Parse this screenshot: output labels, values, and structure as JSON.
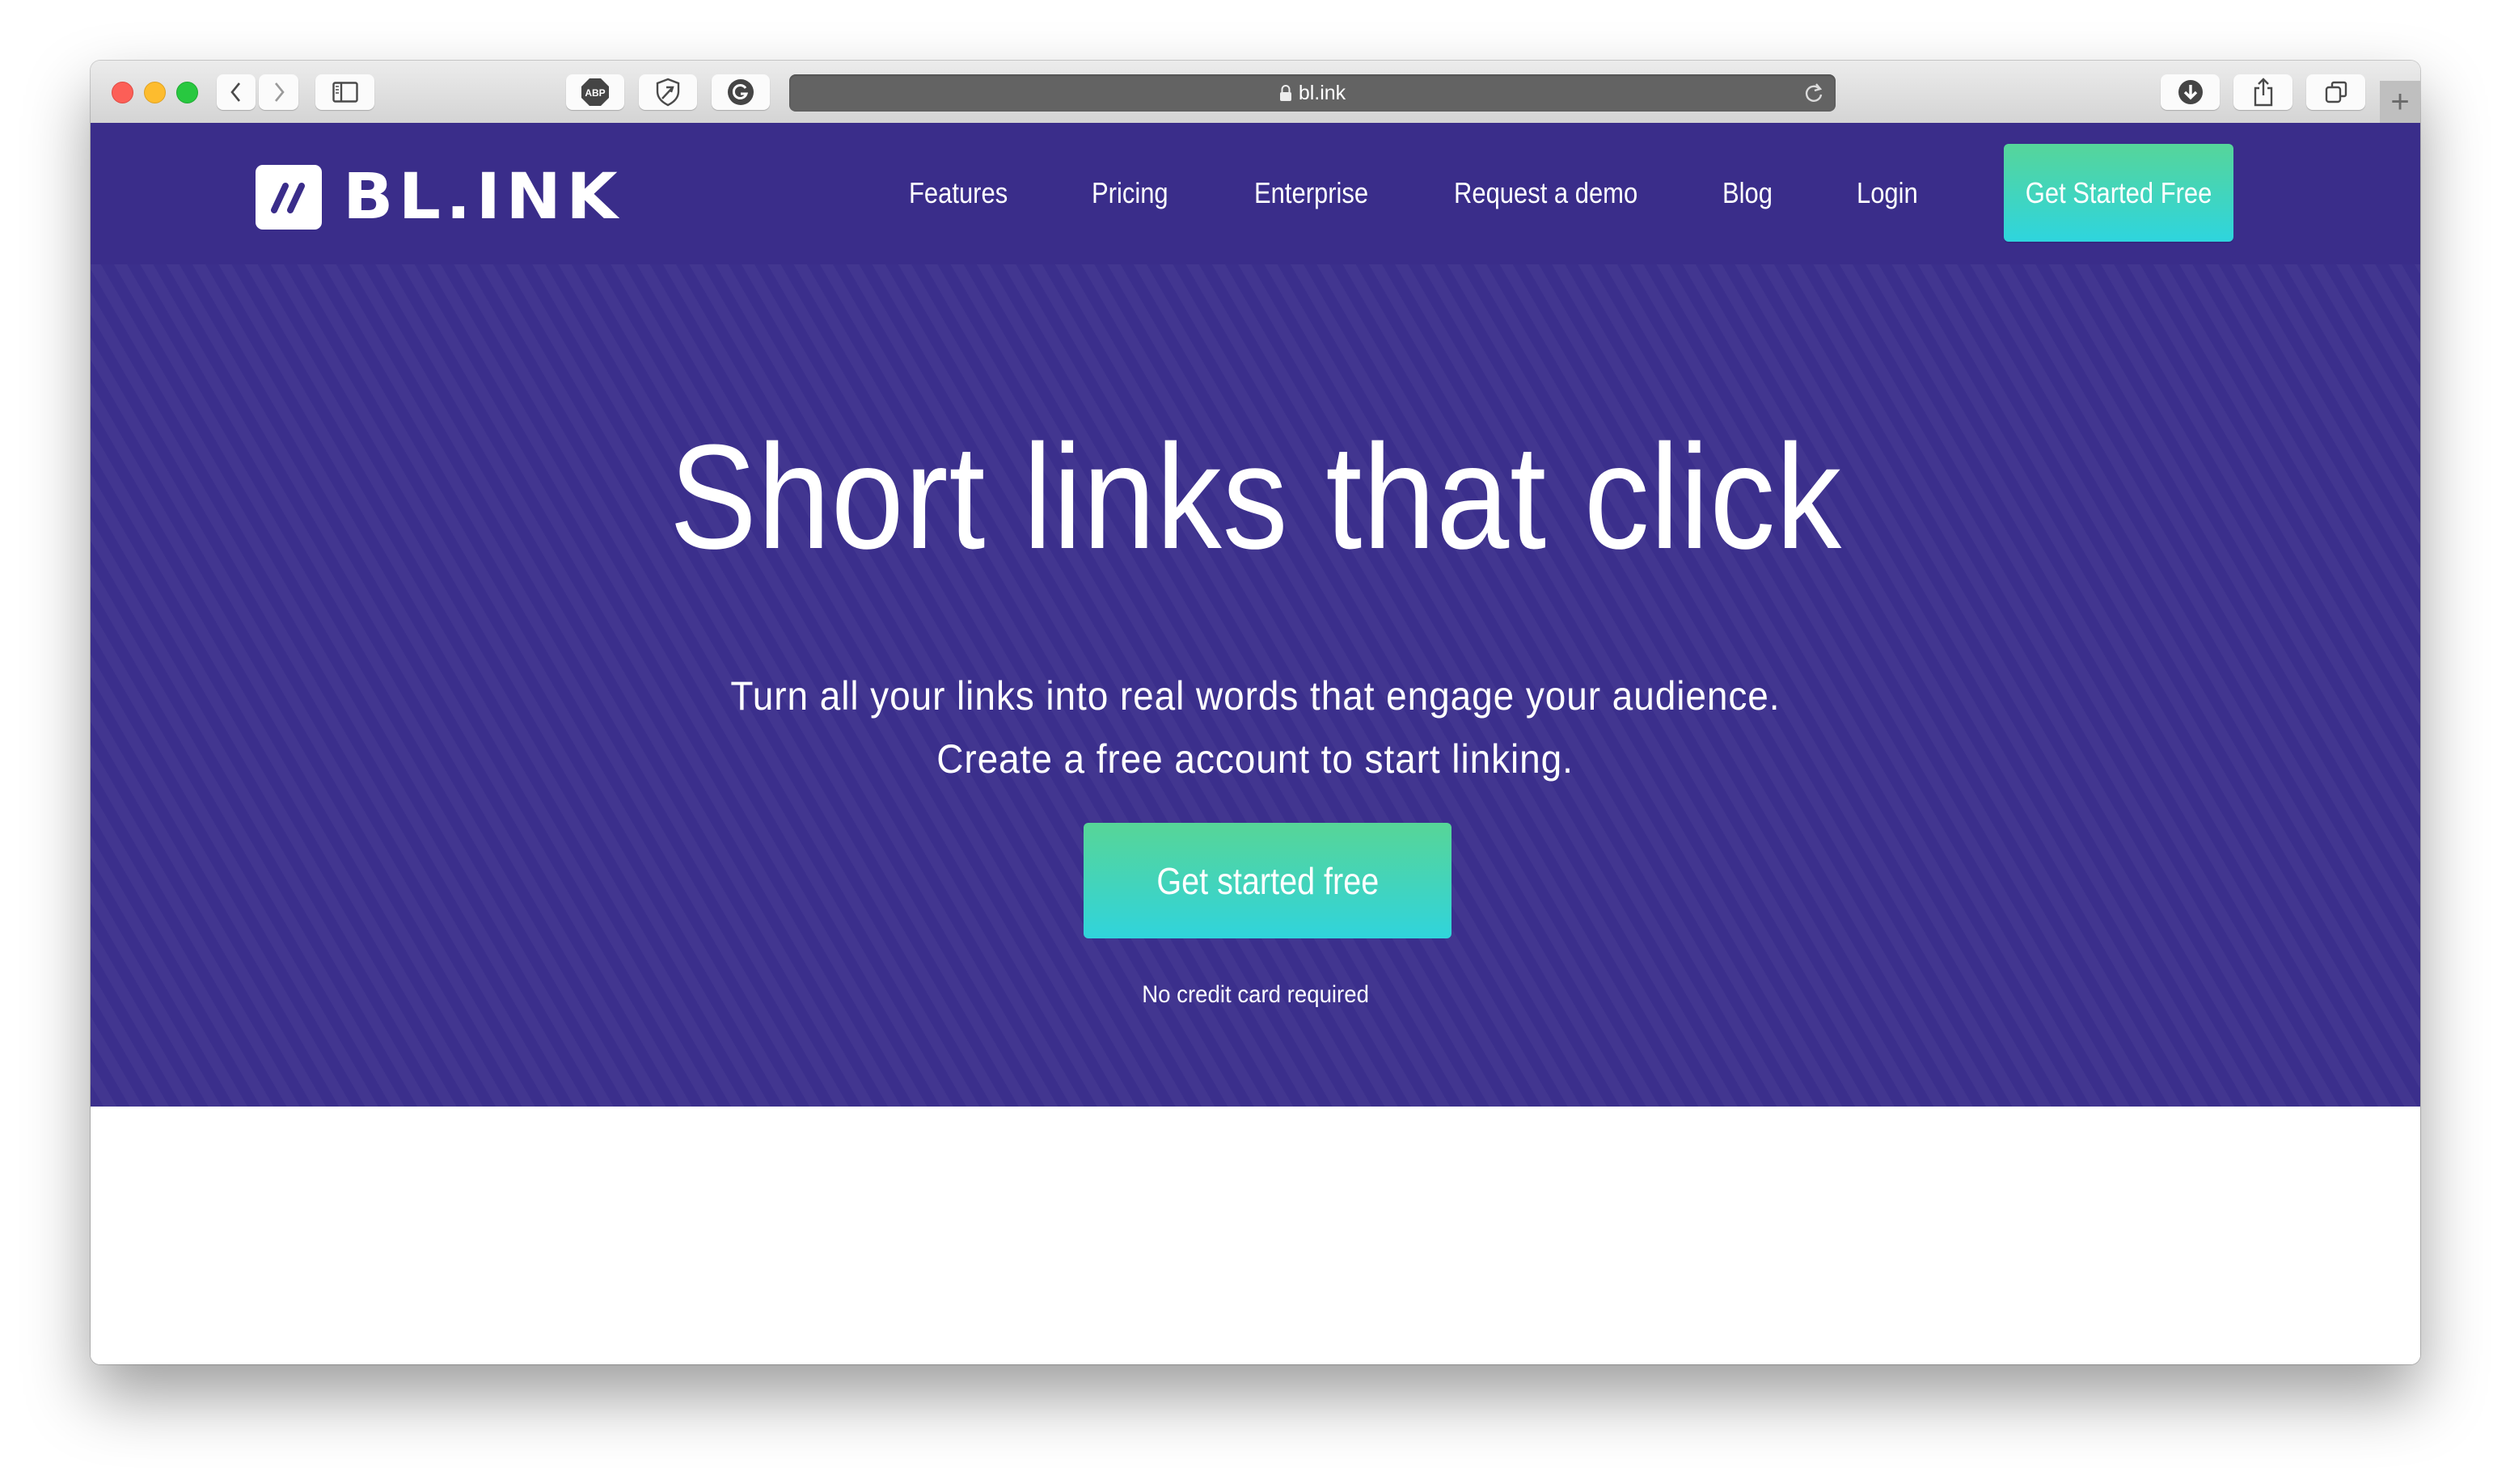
{
  "browser": {
    "url": "bl.ink",
    "extensions": [
      "adblock-plus",
      "privacy-shield",
      "grammarly"
    ],
    "new_tab_label": "+"
  },
  "colors": {
    "brand_purple": "#3a2d8a",
    "cta_gradient_top": "#56d59a",
    "cta_gradient_bottom": "#2ed5de"
  },
  "header": {
    "logo_text": "BL.INK",
    "nav": [
      {
        "label": "Features"
      },
      {
        "label": "Pricing"
      },
      {
        "label": "Enterprise"
      },
      {
        "label": "Request a demo"
      },
      {
        "label": "Blog"
      },
      {
        "label": "Login"
      }
    ],
    "cta_label": "Get Started Free"
  },
  "hero": {
    "title": "Short links that click",
    "subtitle_line1": "Turn all your links into real words that engage your audience.",
    "subtitle_line2": "Create a free account to start linking.",
    "button_label": "Get started free",
    "note": "No credit card required"
  }
}
